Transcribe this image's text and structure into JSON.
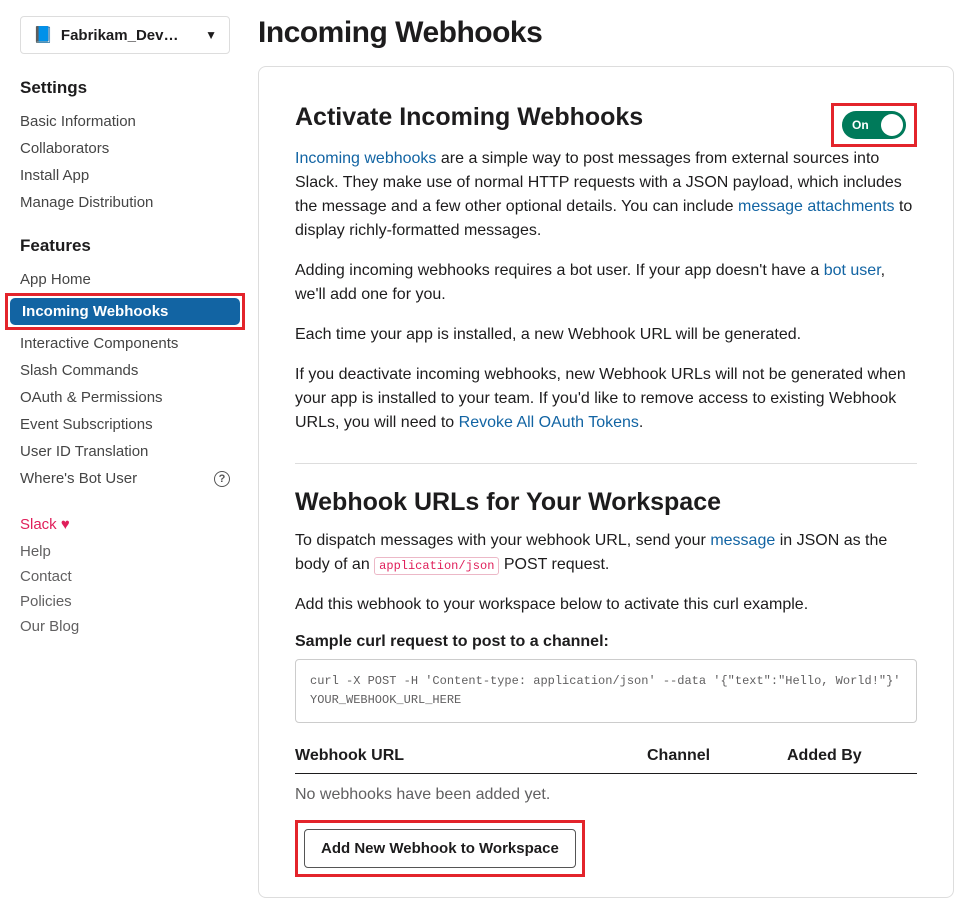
{
  "workspace": {
    "name": "Fabrikam_Dev…",
    "icon": "📘"
  },
  "sidebar": {
    "settings": {
      "header": "Settings",
      "items": [
        {
          "label": "Basic Information"
        },
        {
          "label": "Collaborators"
        },
        {
          "label": "Install App"
        },
        {
          "label": "Manage Distribution"
        }
      ]
    },
    "features": {
      "header": "Features",
      "items": [
        {
          "label": "App Home"
        },
        {
          "label": "Incoming Webhooks",
          "active": true
        },
        {
          "label": "Interactive Components"
        },
        {
          "label": "Slash Commands"
        },
        {
          "label": "OAuth & Permissions"
        },
        {
          "label": "Event Subscriptions"
        },
        {
          "label": "User ID Translation"
        },
        {
          "label": "Where's Bot User"
        }
      ]
    },
    "footer": {
      "slack_link": "Slack ♥",
      "items": [
        {
          "label": "Help"
        },
        {
          "label": "Contact"
        },
        {
          "label": "Policies"
        },
        {
          "label": "Our Blog"
        }
      ]
    }
  },
  "main": {
    "title": "Incoming Webhooks",
    "activate": {
      "heading": "Activate Incoming Webhooks",
      "toggle_label": "On",
      "p1_link": "Incoming webhooks",
      "p1_text_a": " are a simple way to post messages from external sources into Slack. They make use of normal HTTP requests with a JSON payload, which includes the message and a few other optional details. You can include ",
      "p1_link2": "message attachments",
      "p1_text_b": " to display richly-formatted messages.",
      "p2_text_a": "Adding incoming webhooks requires a bot user. If your app doesn't have a ",
      "p2_link": "bot user",
      "p2_text_b": ", we'll add one for you.",
      "p3": "Each time your app is installed, a new Webhook URL will be generated.",
      "p4_text_a": "If you deactivate incoming webhooks, new Webhook URLs will not be generated when your app is installed to your team. If you'd like to remove access to existing Webhook URLs, you will need to ",
      "p4_link": "Revoke All OAuth Tokens",
      "p4_text_b": "."
    },
    "urls": {
      "heading": "Webhook URLs for Your Workspace",
      "p1_text_a": "To dispatch messages with your webhook URL, send your ",
      "p1_link": "message",
      "p1_text_b": " in JSON as the body of an ",
      "p1_code": "application/json",
      "p1_text_c": " POST request.",
      "p2": "Add this webhook to your workspace below to activate this curl example.",
      "sample_label": "Sample curl request to post to a channel:",
      "sample_code": "curl -X POST -H 'Content-type: application/json' --data '{\"text\":\"Hello, World!\"}' YOUR_WEBHOOK_URL_HERE",
      "table": {
        "col1": "Webhook URL",
        "col2": "Channel",
        "col3": "Added By"
      },
      "empty": "No webhooks have been added yet.",
      "add_button": "Add New Webhook to Workspace"
    }
  }
}
